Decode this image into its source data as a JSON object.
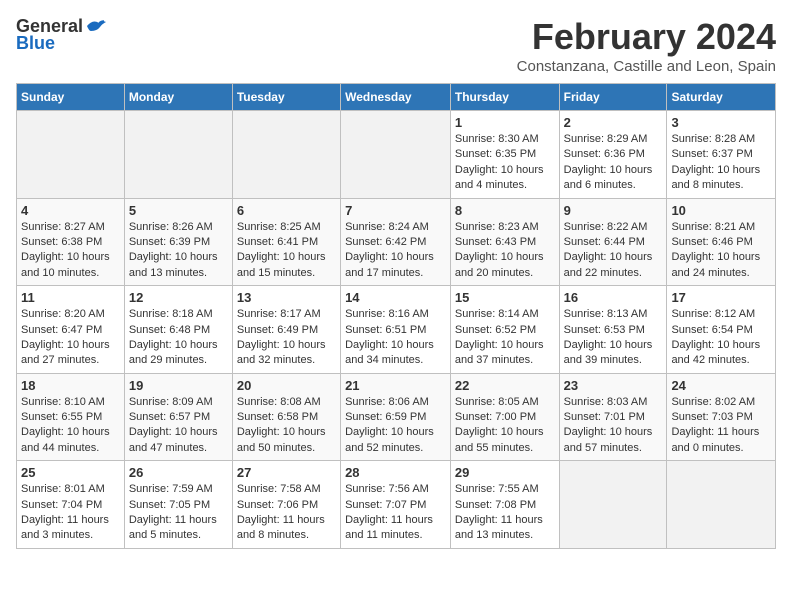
{
  "header": {
    "logo_general": "General",
    "logo_blue": "Blue",
    "month_title": "February 2024",
    "location": "Constanzana, Castille and Leon, Spain"
  },
  "days_of_week": [
    "Sunday",
    "Monday",
    "Tuesday",
    "Wednesday",
    "Thursday",
    "Friday",
    "Saturday"
  ],
  "weeks": [
    [
      {
        "day": "",
        "info": ""
      },
      {
        "day": "",
        "info": ""
      },
      {
        "day": "",
        "info": ""
      },
      {
        "day": "",
        "info": ""
      },
      {
        "day": "1",
        "info": "Sunrise: 8:30 AM\nSunset: 6:35 PM\nDaylight: 10 hours\nand 4 minutes."
      },
      {
        "day": "2",
        "info": "Sunrise: 8:29 AM\nSunset: 6:36 PM\nDaylight: 10 hours\nand 6 minutes."
      },
      {
        "day": "3",
        "info": "Sunrise: 8:28 AM\nSunset: 6:37 PM\nDaylight: 10 hours\nand 8 minutes."
      }
    ],
    [
      {
        "day": "4",
        "info": "Sunrise: 8:27 AM\nSunset: 6:38 PM\nDaylight: 10 hours\nand 10 minutes."
      },
      {
        "day": "5",
        "info": "Sunrise: 8:26 AM\nSunset: 6:39 PM\nDaylight: 10 hours\nand 13 minutes."
      },
      {
        "day": "6",
        "info": "Sunrise: 8:25 AM\nSunset: 6:41 PM\nDaylight: 10 hours\nand 15 minutes."
      },
      {
        "day": "7",
        "info": "Sunrise: 8:24 AM\nSunset: 6:42 PM\nDaylight: 10 hours\nand 17 minutes."
      },
      {
        "day": "8",
        "info": "Sunrise: 8:23 AM\nSunset: 6:43 PM\nDaylight: 10 hours\nand 20 minutes."
      },
      {
        "day": "9",
        "info": "Sunrise: 8:22 AM\nSunset: 6:44 PM\nDaylight: 10 hours\nand 22 minutes."
      },
      {
        "day": "10",
        "info": "Sunrise: 8:21 AM\nSunset: 6:46 PM\nDaylight: 10 hours\nand 24 minutes."
      }
    ],
    [
      {
        "day": "11",
        "info": "Sunrise: 8:20 AM\nSunset: 6:47 PM\nDaylight: 10 hours\nand 27 minutes."
      },
      {
        "day": "12",
        "info": "Sunrise: 8:18 AM\nSunset: 6:48 PM\nDaylight: 10 hours\nand 29 minutes."
      },
      {
        "day": "13",
        "info": "Sunrise: 8:17 AM\nSunset: 6:49 PM\nDaylight: 10 hours\nand 32 minutes."
      },
      {
        "day": "14",
        "info": "Sunrise: 8:16 AM\nSunset: 6:51 PM\nDaylight: 10 hours\nand 34 minutes."
      },
      {
        "day": "15",
        "info": "Sunrise: 8:14 AM\nSunset: 6:52 PM\nDaylight: 10 hours\nand 37 minutes."
      },
      {
        "day": "16",
        "info": "Sunrise: 8:13 AM\nSunset: 6:53 PM\nDaylight: 10 hours\nand 39 minutes."
      },
      {
        "day": "17",
        "info": "Sunrise: 8:12 AM\nSunset: 6:54 PM\nDaylight: 10 hours\nand 42 minutes."
      }
    ],
    [
      {
        "day": "18",
        "info": "Sunrise: 8:10 AM\nSunset: 6:55 PM\nDaylight: 10 hours\nand 44 minutes."
      },
      {
        "day": "19",
        "info": "Sunrise: 8:09 AM\nSunset: 6:57 PM\nDaylight: 10 hours\nand 47 minutes."
      },
      {
        "day": "20",
        "info": "Sunrise: 8:08 AM\nSunset: 6:58 PM\nDaylight: 10 hours\nand 50 minutes."
      },
      {
        "day": "21",
        "info": "Sunrise: 8:06 AM\nSunset: 6:59 PM\nDaylight: 10 hours\nand 52 minutes."
      },
      {
        "day": "22",
        "info": "Sunrise: 8:05 AM\nSunset: 7:00 PM\nDaylight: 10 hours\nand 55 minutes."
      },
      {
        "day": "23",
        "info": "Sunrise: 8:03 AM\nSunset: 7:01 PM\nDaylight: 10 hours\nand 57 minutes."
      },
      {
        "day": "24",
        "info": "Sunrise: 8:02 AM\nSunset: 7:03 PM\nDaylight: 11 hours\nand 0 minutes."
      }
    ],
    [
      {
        "day": "25",
        "info": "Sunrise: 8:01 AM\nSunset: 7:04 PM\nDaylight: 11 hours\nand 3 minutes."
      },
      {
        "day": "26",
        "info": "Sunrise: 7:59 AM\nSunset: 7:05 PM\nDaylight: 11 hours\nand 5 minutes."
      },
      {
        "day": "27",
        "info": "Sunrise: 7:58 AM\nSunset: 7:06 PM\nDaylight: 11 hours\nand 8 minutes."
      },
      {
        "day": "28",
        "info": "Sunrise: 7:56 AM\nSunset: 7:07 PM\nDaylight: 11 hours\nand 11 minutes."
      },
      {
        "day": "29",
        "info": "Sunrise: 7:55 AM\nSunset: 7:08 PM\nDaylight: 11 hours\nand 13 minutes."
      },
      {
        "day": "",
        "info": ""
      },
      {
        "day": "",
        "info": ""
      }
    ]
  ]
}
